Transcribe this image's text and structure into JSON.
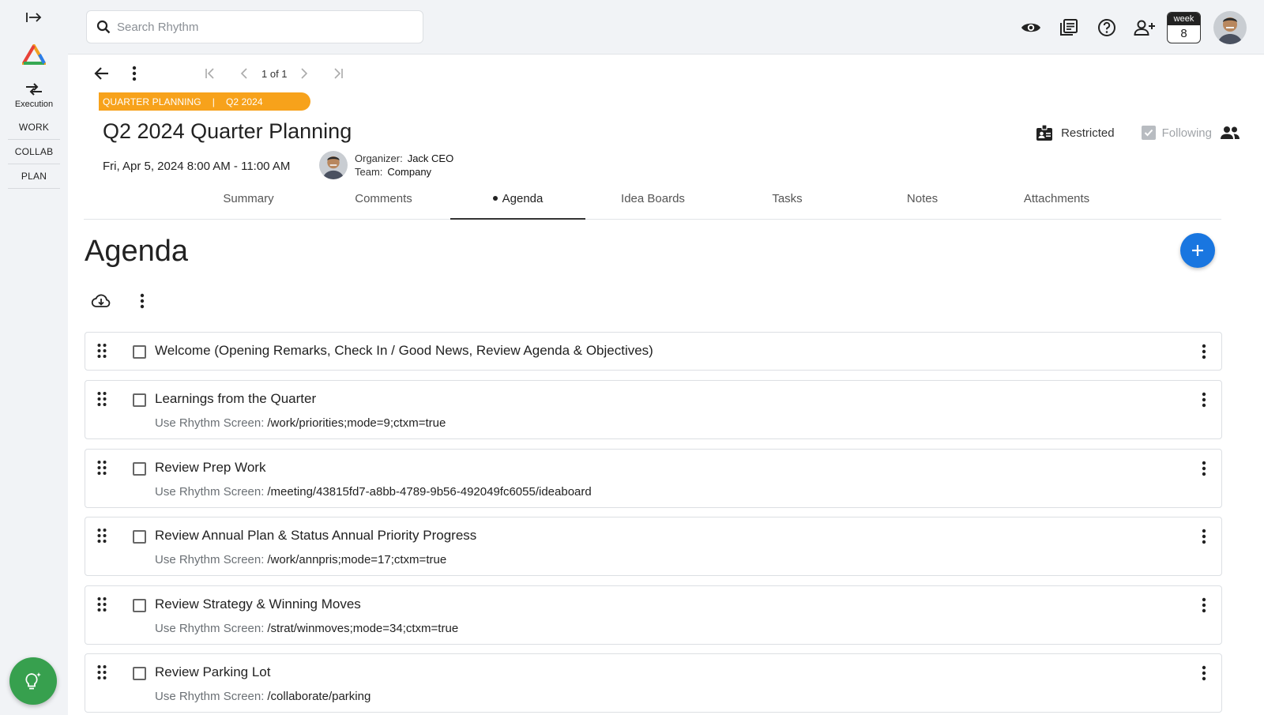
{
  "sidebar": {
    "exec_label": "Execution",
    "nav": [
      "WORK",
      "COLLAB",
      "PLAN"
    ]
  },
  "search": {
    "placeholder": "Search Rhythm"
  },
  "header": {
    "week_label": "week",
    "week_number": "8"
  },
  "pager": {
    "text": "1 of 1"
  },
  "tags": {
    "type": "QUARTER PLANNING",
    "separator": "|",
    "period": "Q2 2024"
  },
  "meeting": {
    "title": "Q2 2024 Quarter Planning",
    "date": "Fri, Apr 5, 2024 8:00 AM - 11:00 AM",
    "organizer_label": "Organizer:",
    "organizer": "Jack CEO",
    "team_label": "Team:",
    "team": "Company",
    "restricted_label": "Restricted",
    "following_label": "Following"
  },
  "tabs": [
    "Summary",
    "Comments",
    "Agenda",
    "Idea Boards",
    "Tasks",
    "Notes",
    "Attachments"
  ],
  "active_tab": "Agenda",
  "agenda": {
    "heading": "Agenda",
    "screen_label": "Use Rhythm Screen:",
    "items": [
      {
        "title": "Welcome (Opening Remarks, Check In / Good News, Review Agenda & Objectives)",
        "screen": ""
      },
      {
        "title": "Learnings from the Quarter",
        "screen": "/work/priorities;mode=9;ctxm=true"
      },
      {
        "title": "Review Prep Work",
        "screen": "/meeting/43815fd7-a8bb-4789-9b56-492049fc6055/ideaboard"
      },
      {
        "title": "Review Annual Plan & Status Annual Priority Progress",
        "screen": "/work/annpris;mode=17;ctxm=true"
      },
      {
        "title": "Review Strategy & Winning Moves",
        "screen": "/strat/winmoves;mode=34;ctxm=true"
      },
      {
        "title": "Review Parking Lot",
        "screen": "/collaborate/parking"
      }
    ]
  },
  "colors": {
    "accent": "#1976e0",
    "tag": "#f7a21b",
    "bulb": "#37a04e"
  }
}
